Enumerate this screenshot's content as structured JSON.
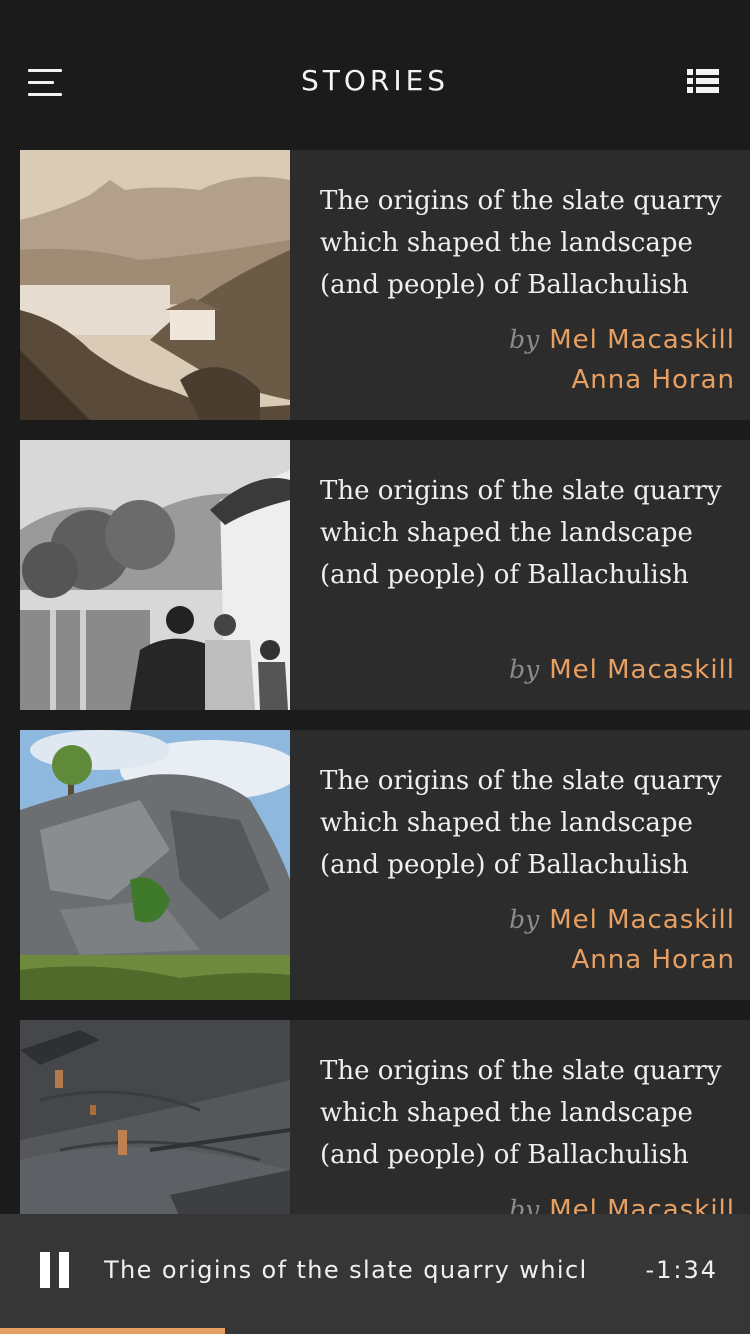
{
  "header": {
    "title": "STORIES"
  },
  "stories": [
    {
      "title": "The origins of the slate quarry which shaped the landscape (and people) of Ballachulish",
      "by": "by",
      "authors": [
        "Mel Macaskill",
        "Anna Horan"
      ],
      "image": "sepia-landscape-photo"
    },
    {
      "title": "The origins of the slate quarry which shaped the landscape (and people) of Ballachulish",
      "by": "by",
      "authors": [
        "Mel Macaskill"
      ],
      "image": "black-and-white-cottage-photo"
    },
    {
      "title": "The origins of the slate quarry which shaped the landscape (and people) of Ballachulish",
      "by": "by",
      "authors": [
        "Mel Macaskill",
        "Anna Horan"
      ],
      "image": "slate-rock-face-photo"
    },
    {
      "title": "The origins of the slate quarry which shaped the landscape (and people) of Ballachulish",
      "by": "by",
      "authors": [
        "Mel Macaskill"
      ],
      "image": "slate-slab-closeup-photo"
    }
  ],
  "player": {
    "now_playing": "The origins of the slate quarry which",
    "remaining": "-1:34",
    "progress": 0.3
  },
  "colors": {
    "accent": "#e7a062",
    "background": "#1b1b1b",
    "card": "#2c2c2c",
    "player": "#363636"
  }
}
